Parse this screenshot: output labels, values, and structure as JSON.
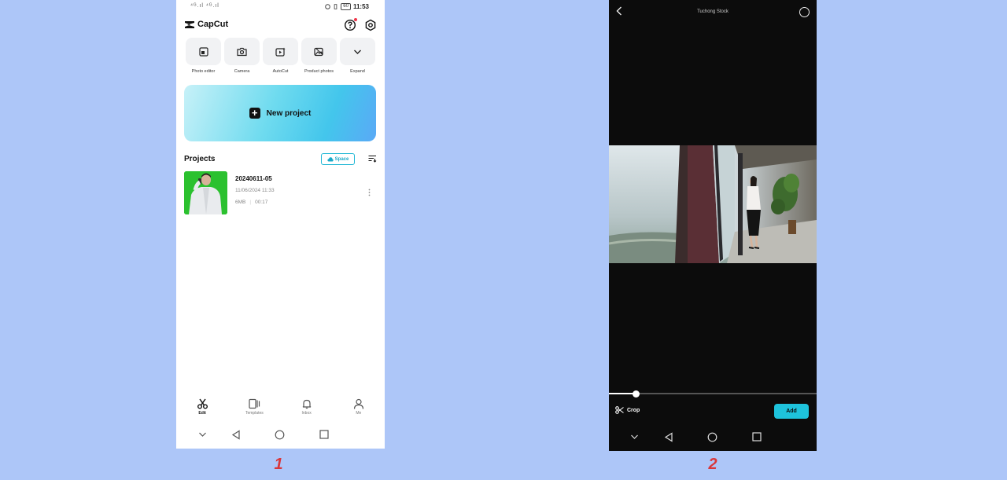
{
  "screen1": {
    "status": {
      "signal": "⁴ᴳ.ıl ⁴ᴳ.ıl",
      "battery": "60",
      "time": "11:53"
    },
    "app_name": "CapCut",
    "tools": [
      {
        "label": "Photo editor",
        "icon": "photo-editor-icon"
      },
      {
        "label": "Camera",
        "icon": "camera-icon"
      },
      {
        "label": "AutoCut",
        "icon": "autocut-icon"
      },
      {
        "label": "Product photos",
        "icon": "product-photos-icon"
      },
      {
        "label": "Expand",
        "icon": "chevron-down-icon"
      }
    ],
    "new_project": "New project",
    "projects_title": "Projects",
    "space_label": "Space",
    "project": {
      "name": "20240611-05",
      "date": "11/06/2024 11:33",
      "size": "6MB",
      "duration": "00:17"
    },
    "nav": [
      {
        "label": "Edit",
        "icon": "scissors-icon",
        "active": true
      },
      {
        "label": "Templates",
        "icon": "templates-icon",
        "active": false
      },
      {
        "label": "Inbox",
        "icon": "bell-icon",
        "active": false
      },
      {
        "label": "Me",
        "icon": "person-icon",
        "active": false
      }
    ],
    "caption": "1"
  },
  "screen2": {
    "title": "Tuchong Stock",
    "crop_label": "Crop",
    "add_label": "Add",
    "progress_fraction": 0.13,
    "caption": "2"
  },
  "colors": {
    "background": "#adc6f8",
    "accent": "#1ec3dc",
    "caption": "#d9363a"
  }
}
